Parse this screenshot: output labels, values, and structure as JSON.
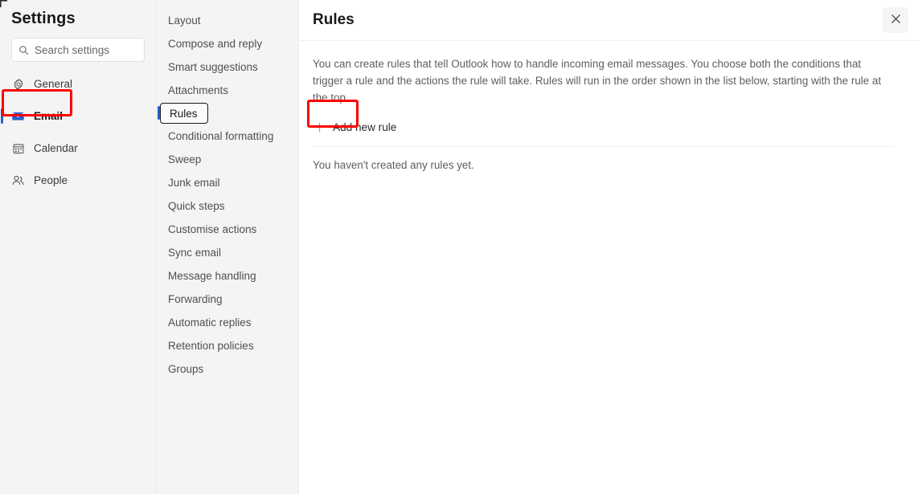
{
  "window": {
    "title": "Settings"
  },
  "search": {
    "placeholder": "Search settings",
    "value": "",
    "icon": "search-icon"
  },
  "sidebar": {
    "title": "Settings",
    "items": [
      {
        "id": "general",
        "label": "General",
        "icon": "gear-icon",
        "selected": false
      },
      {
        "id": "email",
        "label": "Email",
        "icon": "envelope-icon",
        "selected": true
      },
      {
        "id": "calendar",
        "label": "Calendar",
        "icon": "calendar-icon",
        "selected": false
      },
      {
        "id": "people",
        "label": "People",
        "icon": "people-icon",
        "selected": false
      }
    ]
  },
  "nav": {
    "items": [
      {
        "id": "layout",
        "label": "Layout",
        "active": false
      },
      {
        "id": "compose-and-reply",
        "label": "Compose and reply",
        "active": false
      },
      {
        "id": "smart-suggestions",
        "label": "Smart suggestions",
        "active": false
      },
      {
        "id": "attachments",
        "label": "Attachments",
        "active": false
      },
      {
        "id": "rules",
        "label": "Rules",
        "active": true
      },
      {
        "id": "conditional-formatting",
        "label": "Conditional formatting",
        "active": false
      },
      {
        "id": "sweep",
        "label": "Sweep",
        "active": false
      },
      {
        "id": "junk-email",
        "label": "Junk email",
        "active": false
      },
      {
        "id": "quick-steps",
        "label": "Quick steps",
        "active": false
      },
      {
        "id": "customise-actions",
        "label": "Customise actions",
        "active": false
      },
      {
        "id": "sync-email",
        "label": "Sync email",
        "active": false
      },
      {
        "id": "message-handling",
        "label": "Message handling",
        "active": false
      },
      {
        "id": "forwarding",
        "label": "Forwarding",
        "active": false
      },
      {
        "id": "automatic-replies",
        "label": "Automatic replies",
        "active": false
      },
      {
        "id": "retention-policies",
        "label": "Retention policies",
        "active": false
      },
      {
        "id": "groups",
        "label": "Groups",
        "active": false
      }
    ]
  },
  "main": {
    "title": "Rules",
    "close_icon": "close-icon",
    "description": "You can create rules that tell Outlook how to handle incoming email messages. You choose both the conditions that trigger a rule and the actions the rule will take. Rules will run in the order shown in the list below, starting with the rule at the top.",
    "add_rule_label": "Add new rule",
    "add_rule_icon": "plus-icon",
    "empty_message": "You haven't created any rules yet."
  },
  "annotations": [
    {
      "id": "email-highlight",
      "target": "sidebar-item-email",
      "color": "#fe0000"
    },
    {
      "id": "rules-highlight",
      "target": "nav-item-rules",
      "color": "#fe0000"
    }
  ],
  "colors": {
    "accent_blue": "#2563c9",
    "icon_blue": "#1b55b8",
    "plus_blue": "#7aa6dd",
    "annotation_red": "#fe0000",
    "panel_gray": "#f4f4f4",
    "text_primary": "#1b1a19",
    "text_secondary": "#605e5c"
  }
}
